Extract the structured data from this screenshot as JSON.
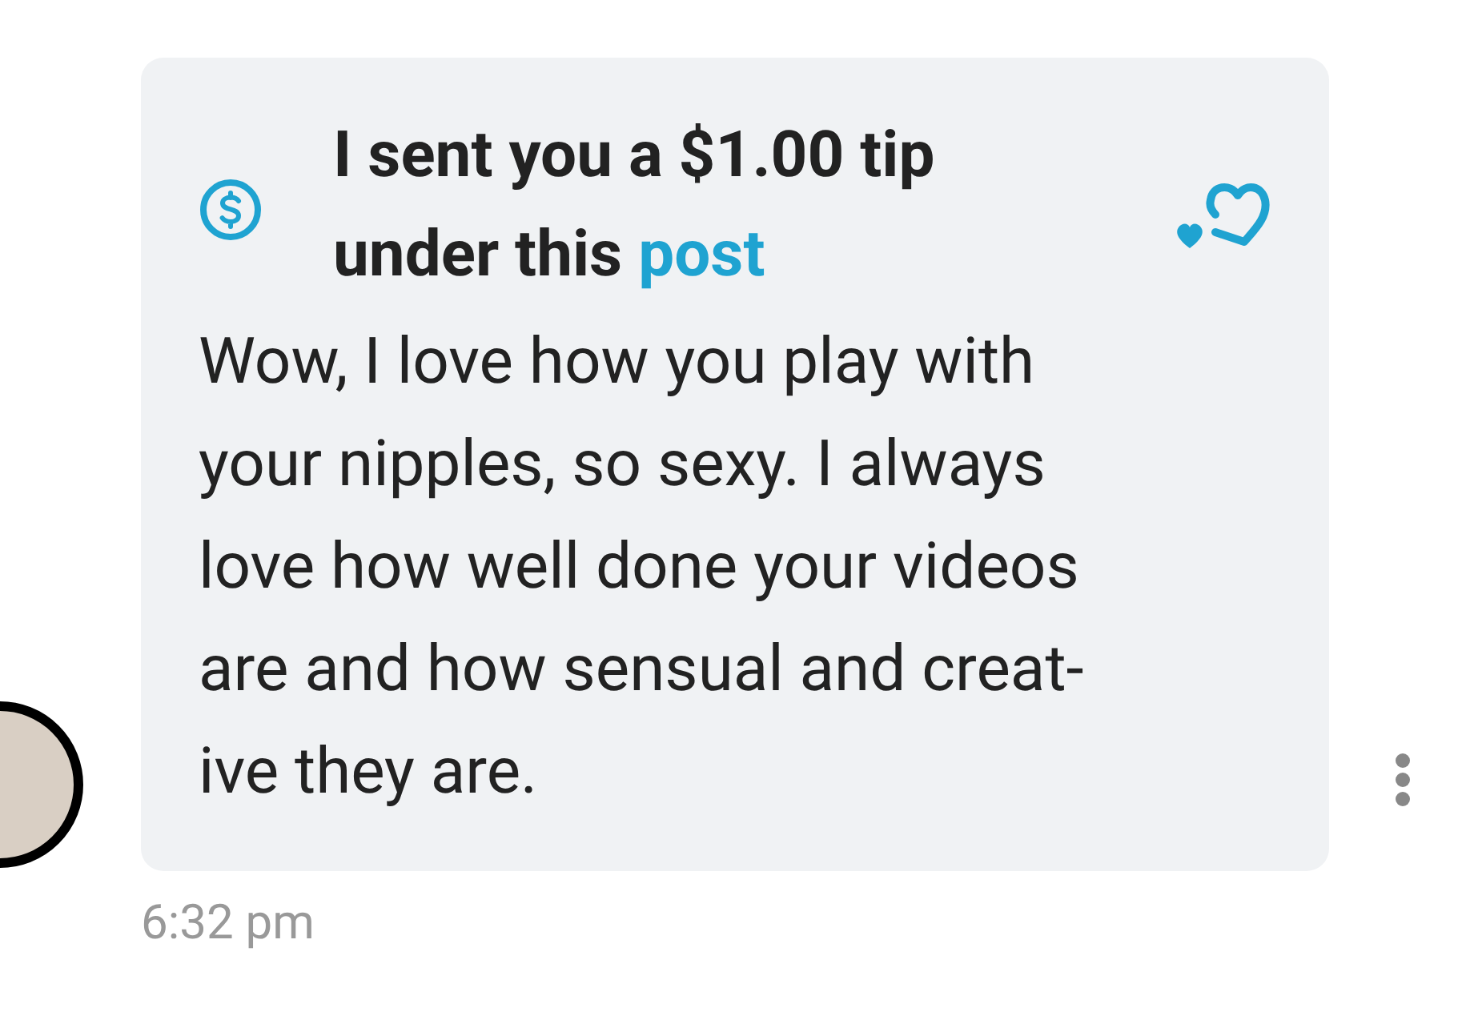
{
  "message": {
    "tip_text": "I sent you a $1.00 tip under this",
    "tip_link": "post",
    "body_lines": [
      "Wow, I love how you play with",
      "your nipples, so sexy. I always",
      "love how well done your videos",
      "are and how sensual and creat-",
      "ive they are."
    ],
    "time": "6:32 pm"
  }
}
